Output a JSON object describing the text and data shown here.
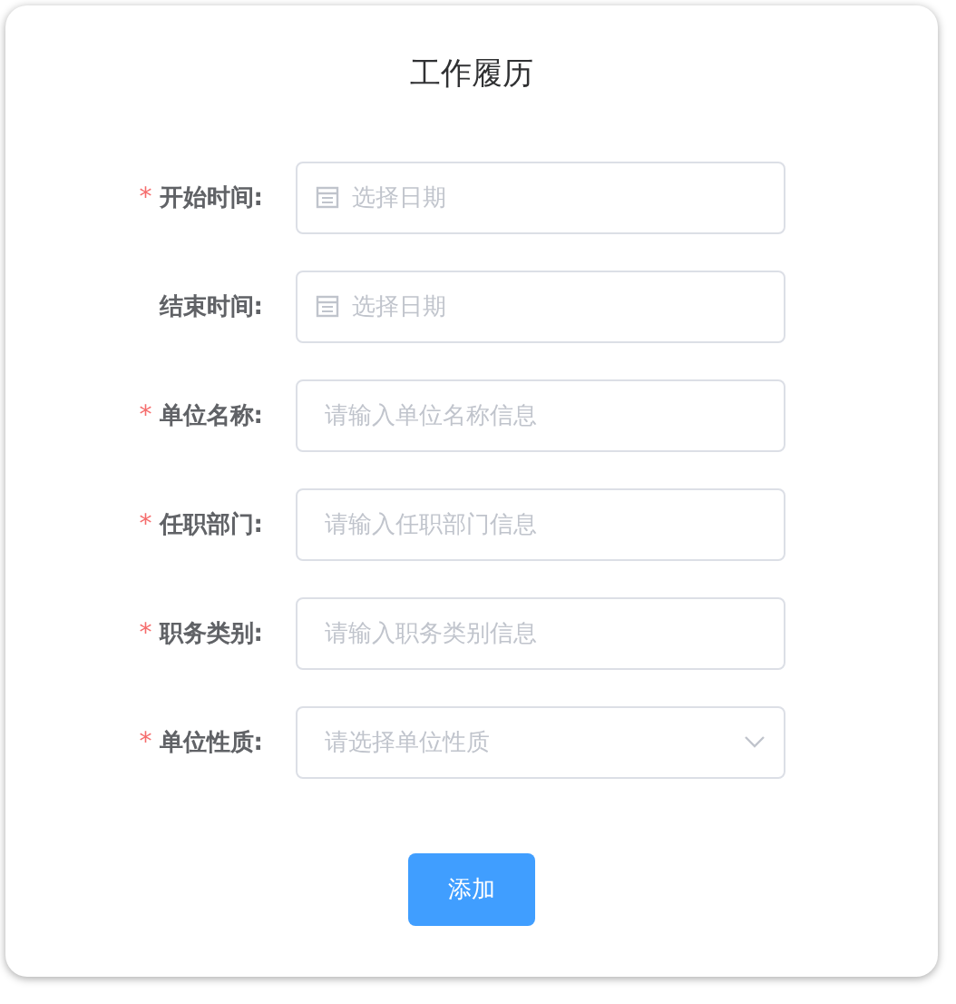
{
  "title": "工作履历",
  "fields": [
    {
      "kind": "date",
      "label": "开始时间:",
      "required_mark": "*",
      "placeholder": "选择日期"
    },
    {
      "kind": "date",
      "label": "结束时间:",
      "placeholder": "选择日期"
    },
    {
      "kind": "text",
      "label": "单位名称:",
      "required_mark": "*",
      "placeholder": "请输入单位名称信息"
    },
    {
      "kind": "text",
      "label": "任职部门:",
      "required_mark": "*",
      "placeholder": "请输入任职部门信息"
    },
    {
      "kind": "text",
      "label": "职务类别:",
      "required_mark": "*",
      "placeholder": "请输入职务类别信息"
    },
    {
      "kind": "select",
      "label": "单位性质:",
      "required_mark": "*",
      "placeholder": "请选择单位性质"
    }
  ],
  "button": "添加"
}
